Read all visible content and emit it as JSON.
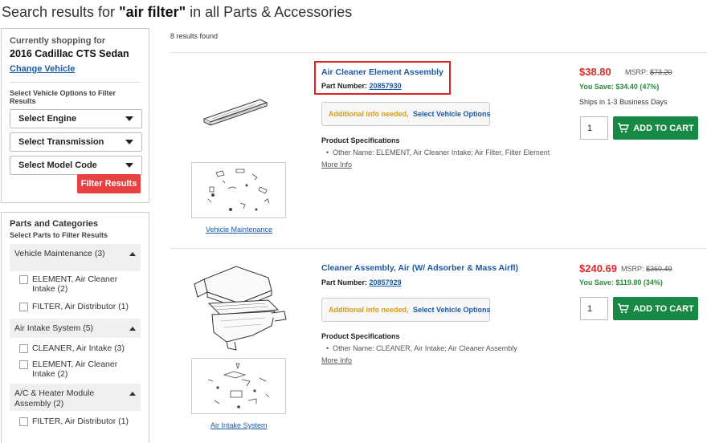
{
  "page": {
    "title_prefix": "Search results for ",
    "query": "\"air filter\"",
    "title_suffix": " in all Parts & Accessories"
  },
  "vehicle": {
    "currently_label": "Currently shopping for",
    "vehicle_name": "2016 Cadillac CTS Sedan",
    "change_label": "Change Vehicle",
    "options_label": "Select Vehicle Options to Filter Results",
    "selects": [
      "Select Engine",
      "Select Transmission",
      "Select Model Code"
    ],
    "filter_label": "Filter Results"
  },
  "categories": {
    "title": "Parts and Categories",
    "subtitle": "Select Parts to Filter Results",
    "groups": [
      {
        "name": "Vehicle Maintenance (3)",
        "items": [
          "ELEMENT, Air Cleaner Intake (2)",
          "FILTER, Air Distributor (1)"
        ]
      },
      {
        "name": "Air Intake System (5)",
        "items": [
          "CLEANER, Air Intake (3)",
          "ELEMENT, Air Cleaner Intake (2)"
        ]
      },
      {
        "name": "A/C & Heater Module Assembly (2)",
        "items": [
          "FILTER, Air Distributor (1)"
        ]
      }
    ]
  },
  "results": {
    "count_label": "8 results found",
    "items": [
      {
        "name": "Air Cleaner Element Assembly",
        "part_label": "Part Number:",
        "part_number": "20857930",
        "info_needed": "Additional info needed,",
        "info_link": "Select Vehicle Options",
        "spec_title": "Product Specifications",
        "spec_item": "Other Name: ELEMENT, Air Cleaner Intake; Air Filter, Filter Element",
        "more_info": "More Info",
        "diagram_link": "Vehicle Maintenance",
        "price": "$38.80",
        "msrp_label": "MSRP:",
        "msrp": "$73.20",
        "save": "You Save: $34.40 (47%)",
        "ships": "Ships in 1-3 Business Days",
        "qty": "1",
        "cart_label": "ADD TO CART"
      },
      {
        "name": "Cleaner Assembly, Air (W/ Adsorber & Mass Airfl)",
        "part_label": "Part Number:",
        "part_number": "20857929",
        "info_needed": "Additional info needed,",
        "info_link": "Select Vehicle Options",
        "spec_title": "Product Specifications",
        "spec_item": "Other Name: CLEANER, Air Intake; Air Cleaner Assembly",
        "more_info": "More Info",
        "diagram_link": "Air Intake System",
        "price": "$240.69",
        "msrp_label": "MSRP:",
        "msrp": "$360.49",
        "save": "You Save: $119.80 (34%)",
        "qty": "1",
        "cart_label": "ADD TO CART"
      }
    ]
  },
  "colors": {
    "link": "#1a5aa5",
    "price": "#d42d2d",
    "save": "#2a8a3a",
    "cart": "#168a44",
    "filter_button": "#e84141",
    "info_amber": "#d99a17",
    "highlight": "#e02020"
  }
}
